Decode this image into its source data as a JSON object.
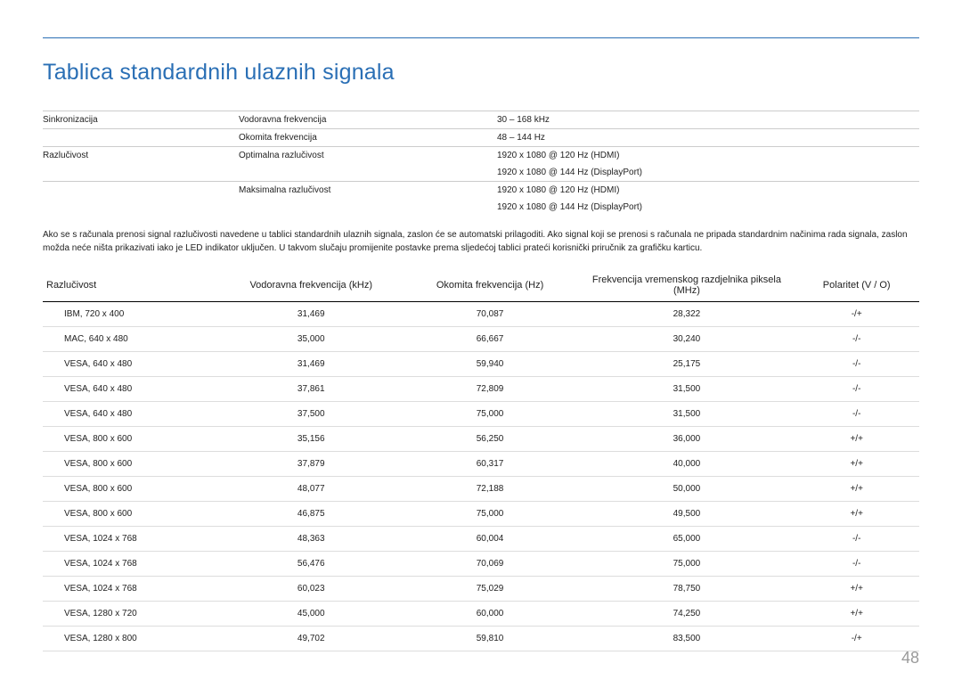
{
  "title": "Tablica standardnih ulaznih signala",
  "page_number": "48",
  "specs": {
    "rows": [
      {
        "c1": "Sinkronizacija",
        "c2": "Vodoravna frekvencija",
        "c3": "30 – 168 kHz",
        "border": true
      },
      {
        "c1": "",
        "c2": "Okomita frekvencija",
        "c3": "48 – 144 Hz",
        "border": true
      },
      {
        "c1": "Razlučivost",
        "c2": "Optimalna razlučivost",
        "c3": "1920 x 1080 @ 120 Hz (HDMI)",
        "border": true
      },
      {
        "c1": "",
        "c2": "",
        "c3": "1920 x 1080 @ 144 Hz (DisplayPort)",
        "border": false
      },
      {
        "c1": "",
        "c2": "Maksimalna razlučivost",
        "c3": "1920 x 1080 @ 120 Hz (HDMI)",
        "border": true
      },
      {
        "c1": "",
        "c2": "",
        "c3": "1920 x 1080 @ 144 Hz (DisplayPort)",
        "border": false
      }
    ]
  },
  "description": "Ako se s računala prenosi signal razlučivosti navedene u tablici standardnih ulaznih signala, zaslon će se automatski prilagoditi. Ako signal koji se prenosi s računala ne pripada standardnim načinima rada signala, zaslon možda neće ništa prikazivati iako je LED indikator uključen. U takvom slučaju promijenite postavke prema sljedećoj tablici prateći korisnički priručnik za grafičku karticu.",
  "headers": {
    "h1": "Razlučivost",
    "h2": "Vodoravna frekvencija (kHz)",
    "h3": "Okomita frekvencija (Hz)",
    "h4": "Frekvencija vremenskog razdjelnika piksela (MHz)",
    "h5": "Polaritet (V / O)"
  },
  "rows": [
    {
      "res": "IBM, 720 x 400",
      "hf": "31,469",
      "vf": "70,087",
      "pc": "28,322",
      "pol": "-/+"
    },
    {
      "res": "MAC, 640 x 480",
      "hf": "35,000",
      "vf": "66,667",
      "pc": "30,240",
      "pol": "-/-"
    },
    {
      "res": "VESA, 640 x 480",
      "hf": "31,469",
      "vf": "59,940",
      "pc": "25,175",
      "pol": "-/-"
    },
    {
      "res": "VESA, 640 x 480",
      "hf": "37,861",
      "vf": "72,809",
      "pc": "31,500",
      "pol": "-/-"
    },
    {
      "res": "VESA, 640 x 480",
      "hf": "37,500",
      "vf": "75,000",
      "pc": "31,500",
      "pol": "-/-"
    },
    {
      "res": "VESA, 800 x 600",
      "hf": "35,156",
      "vf": "56,250",
      "pc": "36,000",
      "pol": "+/+"
    },
    {
      "res": "VESA, 800 x 600",
      "hf": "37,879",
      "vf": "60,317",
      "pc": "40,000",
      "pol": "+/+"
    },
    {
      "res": "VESA, 800 x 600",
      "hf": "48,077",
      "vf": "72,188",
      "pc": "50,000",
      "pol": "+/+"
    },
    {
      "res": "VESA, 800 x 600",
      "hf": "46,875",
      "vf": "75,000",
      "pc": "49,500",
      "pol": "+/+"
    },
    {
      "res": "VESA, 1024 x 768",
      "hf": "48,363",
      "vf": "60,004",
      "pc": "65,000",
      "pol": "-/-"
    },
    {
      "res": "VESA, 1024 x 768",
      "hf": "56,476",
      "vf": "70,069",
      "pc": "75,000",
      "pol": "-/-"
    },
    {
      "res": "VESA, 1024 x 768",
      "hf": "60,023",
      "vf": "75,029",
      "pc": "78,750",
      "pol": "+/+"
    },
    {
      "res": "VESA, 1280 x 720",
      "hf": "45,000",
      "vf": "60,000",
      "pc": "74,250",
      "pol": "+/+"
    },
    {
      "res": "VESA, 1280 x 800",
      "hf": "49,702",
      "vf": "59,810",
      "pc": "83,500",
      "pol": "-/+"
    }
  ]
}
